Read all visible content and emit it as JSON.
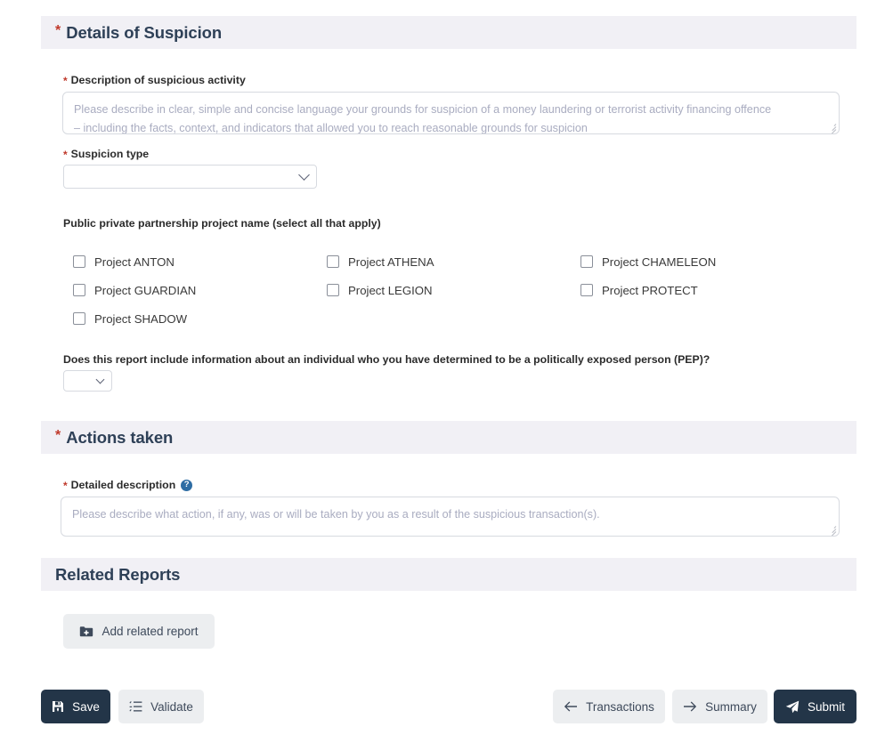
{
  "sections": {
    "details": {
      "title": "Details of Suspicion",
      "required": true,
      "description_label": "Description of suspicious activity",
      "description_placeholder_line1": "Please describe in clear, simple and concise language your grounds for suspicion of a money laundering or terrorist activity financing offence",
      "description_placeholder_line2": "– including the facts, context, and indicators that allowed you to reach reasonable grounds for suspicion",
      "description_value": "",
      "suspicion_type_label": "Suspicion type",
      "suspicion_type_value": "",
      "ppp_label": "Public private partnership project name (select all that apply)",
      "ppp_options": [
        {
          "label": "Project ANTON",
          "checked": false
        },
        {
          "label": "Project ATHENA",
          "checked": false
        },
        {
          "label": "Project CHAMELEON",
          "checked": false
        },
        {
          "label": "Project GUARDIAN",
          "checked": false
        },
        {
          "label": "Project LEGION",
          "checked": false
        },
        {
          "label": "Project PROTECT",
          "checked": false
        },
        {
          "label": "Project SHADOW",
          "checked": false
        }
      ],
      "pep_label": "Does this report include information about an individual who you have determined to be a politically exposed person (PEP)?",
      "pep_value": ""
    },
    "actions": {
      "title": "Actions taken",
      "required": true,
      "detailed_label": "Detailed description",
      "detailed_help": "?",
      "detailed_placeholder": "Please describe what action, if any, was or will be taken by you as a result of the suspicious transaction(s).",
      "detailed_value": ""
    },
    "related": {
      "title": "Related Reports",
      "add_button_label": "Add related report"
    }
  },
  "footer": {
    "save_label": "Save",
    "validate_label": "Validate",
    "transactions_label": "Transactions",
    "summary_label": "Summary",
    "submit_label": "Submit"
  },
  "colors": {
    "section_header_bg": "#f1f0f5",
    "heading_text": "#2e4057",
    "required_star": "#c0392b",
    "dark_button": "#233548",
    "light_button": "#eceef0",
    "help_blue": "#2e6da4",
    "placeholder_text": "#a9acc0"
  }
}
